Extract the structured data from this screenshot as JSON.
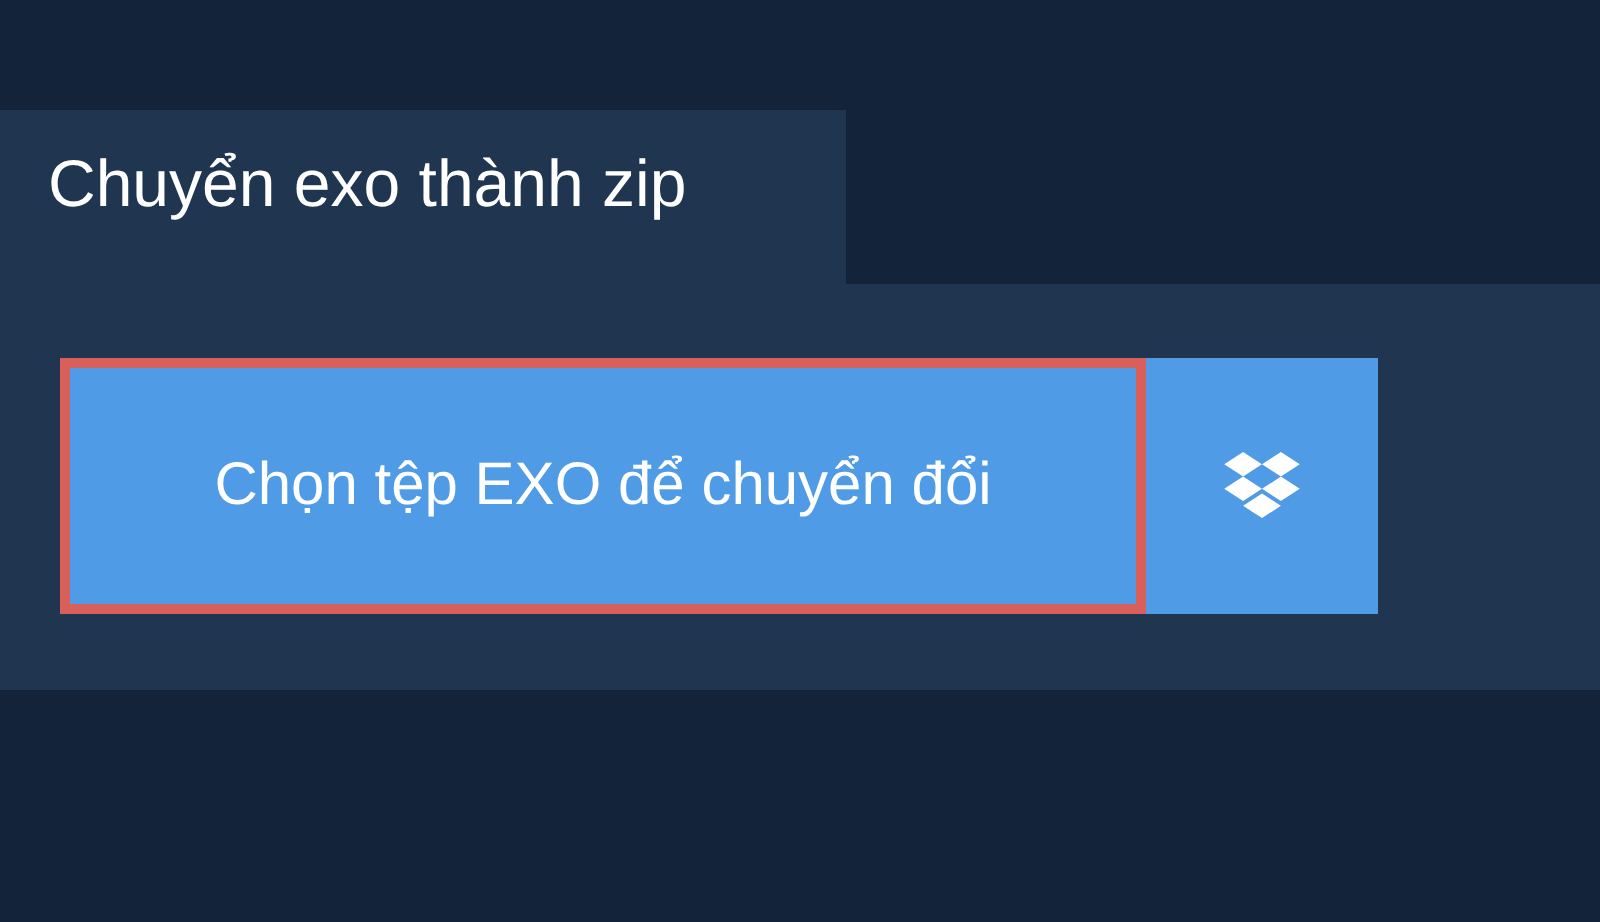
{
  "tab": {
    "label": "Chuyển exo thành zip"
  },
  "buttons": [
    {
      "kind": "file",
      "label": "Chọn tệp EXO để chuyển đổi",
      "focused": true
    },
    {
      "kind": "dropbox",
      "focused": false
    }
  ]
}
